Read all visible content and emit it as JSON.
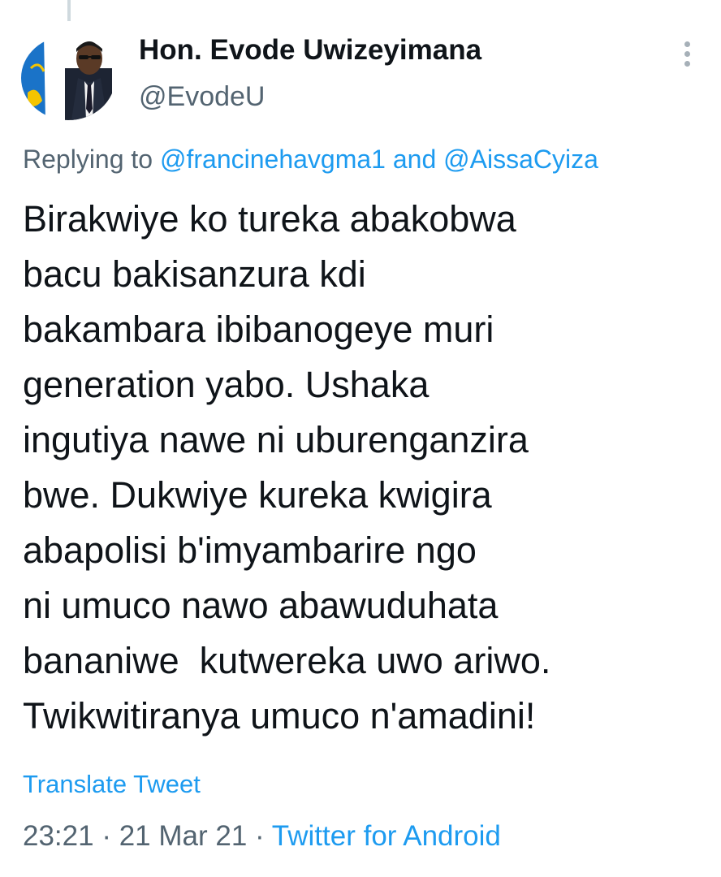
{
  "author": {
    "display_name": "Hon. Evode Uwizeyimana",
    "handle": "@EvodeU"
  },
  "reply_context": {
    "prefix": "Replying to",
    "mention_1": "@francinehavgma1",
    "conjunction": "and",
    "mention_2": "@AissaCyiza"
  },
  "tweet": {
    "lines": [
      "Birakwiye ko tureka abakobwa",
      "bacu bakisanzura kdi",
      "bakambara ibibanogeye muri",
      "generation yabo. Ushaka",
      "ingutiya nawe ni uburenganzira",
      "bwe. Dukwiye kureka kwigira",
      "abapolisi b'imyambarire ngo",
      "ni umuco nawo abawuduhata",
      "bananiwe  kutwereka uwo ariwo.",
      "Twikwitiranya umuco n'amadini!"
    ]
  },
  "actions": {
    "translate_label": "Translate Tweet"
  },
  "meta": {
    "time": "23:21",
    "separator": "·",
    "date": "21 Mar 21",
    "source": "Twitter for Android"
  },
  "icons": {
    "more": "more-vertical-icon"
  },
  "colors": {
    "link": "#1d9bf0",
    "secondary_text": "#536471",
    "primary_text": "#0f1419"
  }
}
